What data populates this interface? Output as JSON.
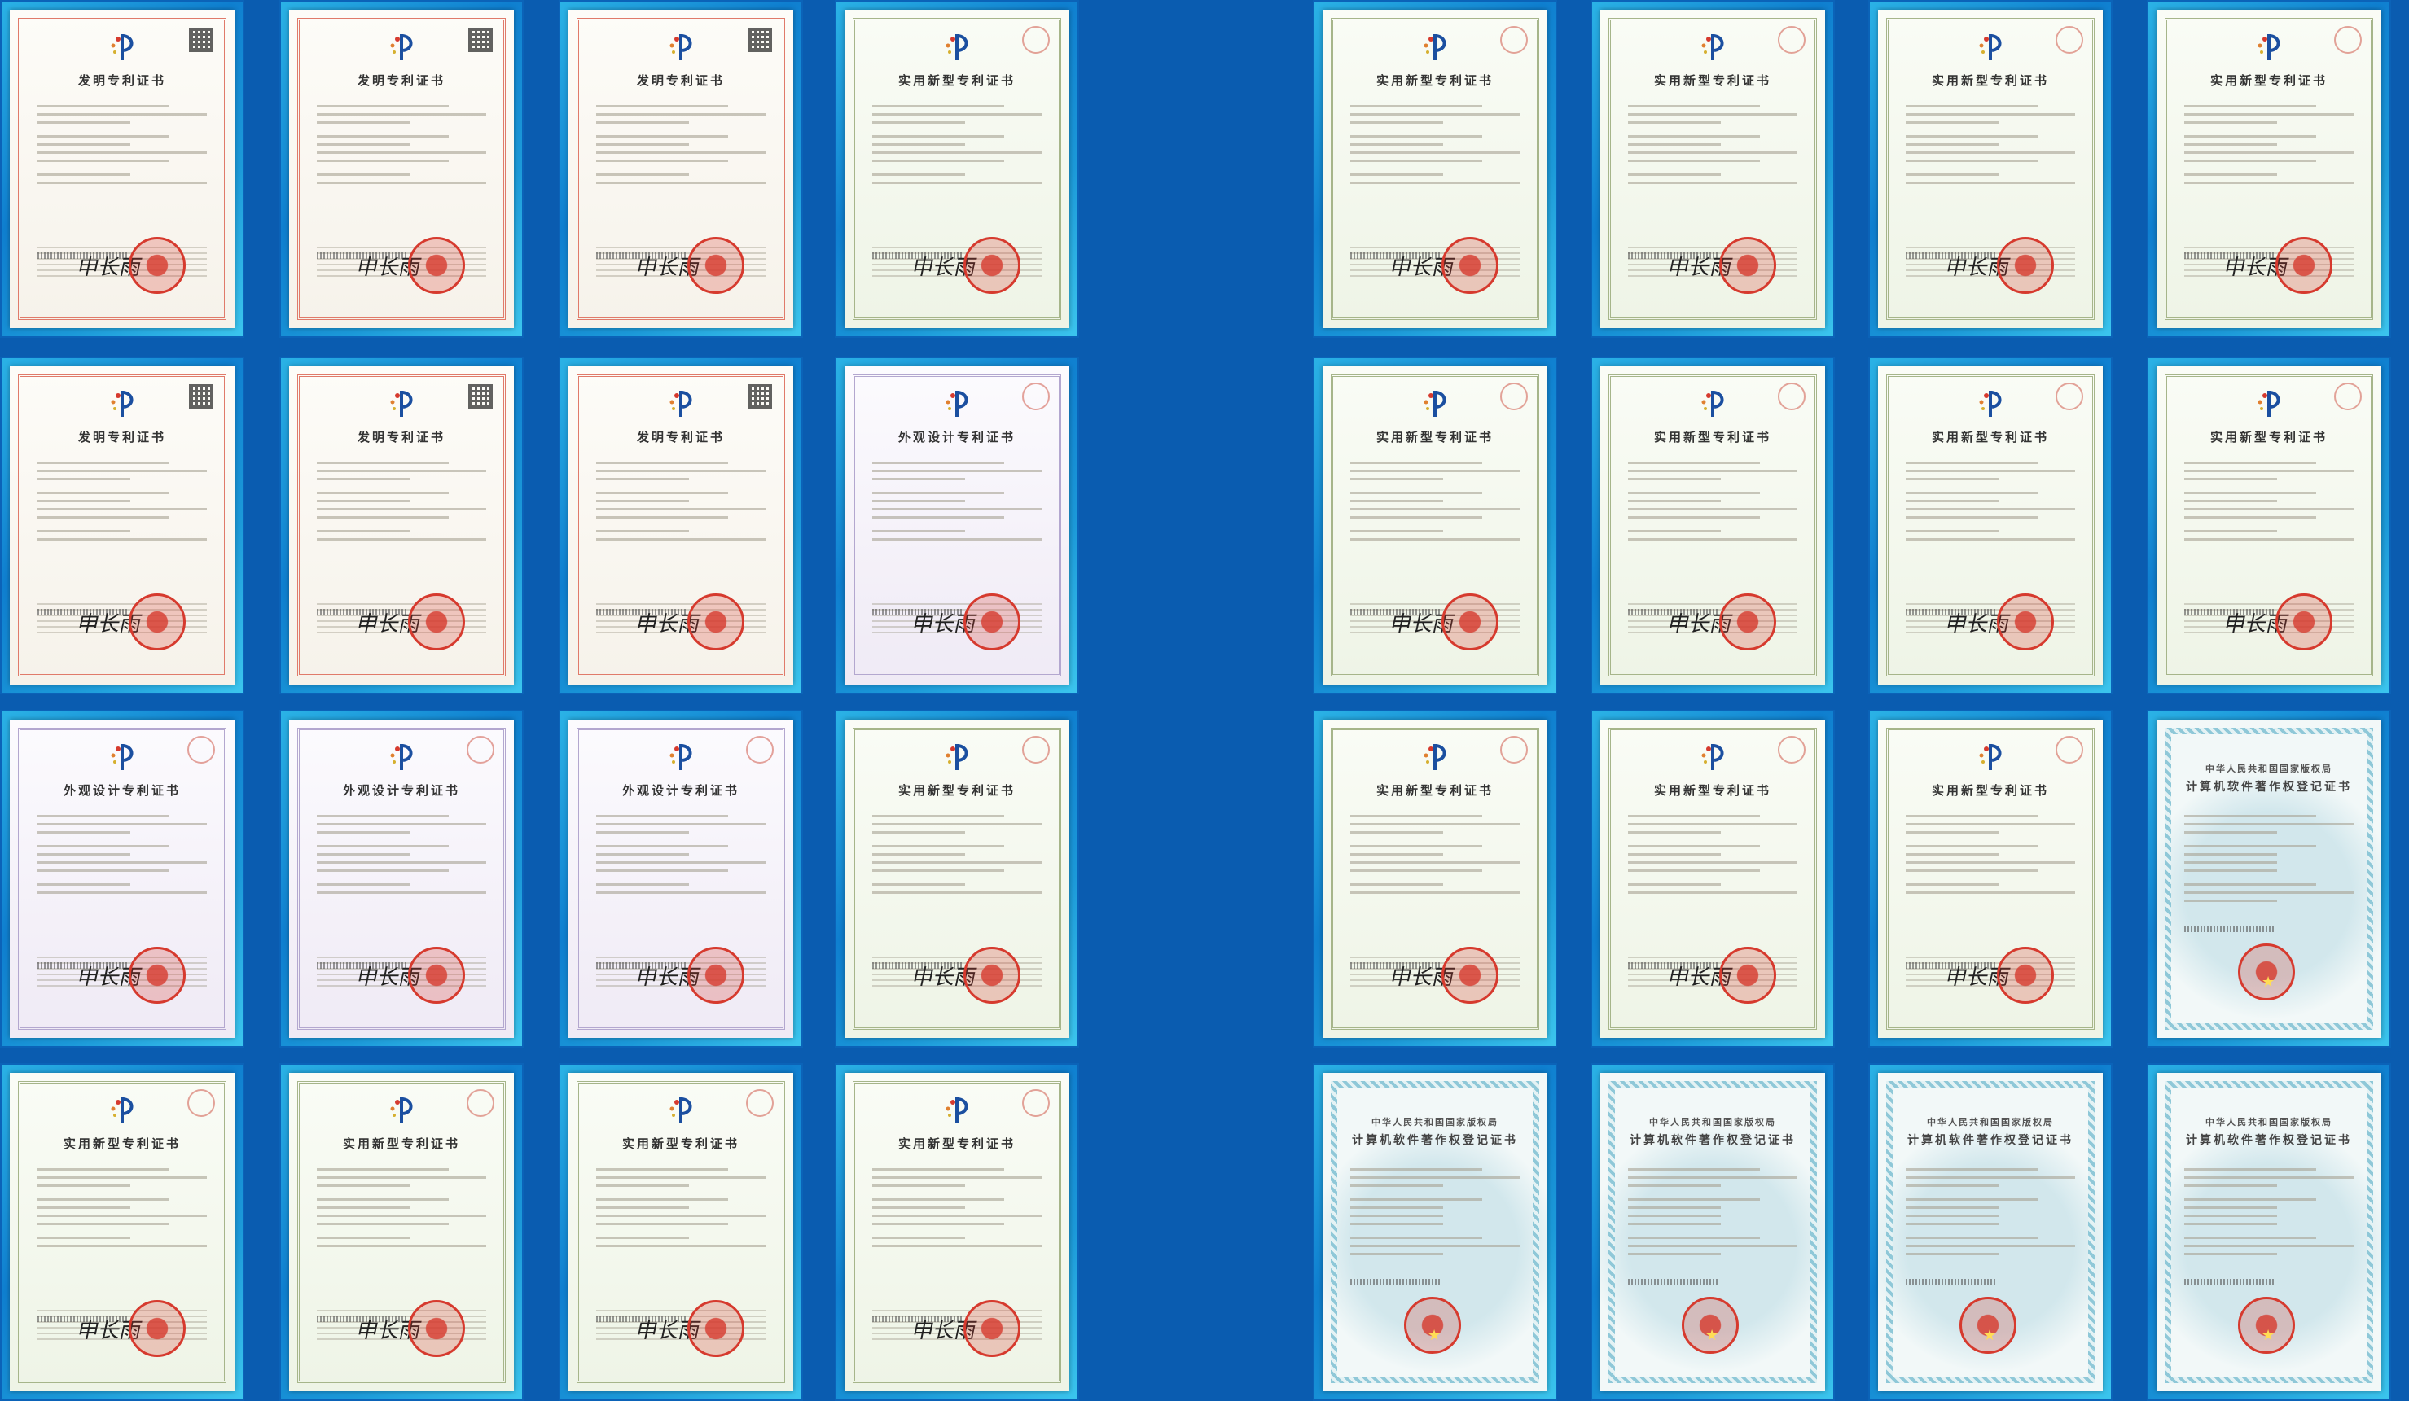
{
  "background_color": "#0a5cb0",
  "certificate_types": {
    "invention": "发明专利证书",
    "utility": "实用新型专利证书",
    "design": "外观设计专利证书",
    "software_org": "中华人民共和国国家版权局",
    "software": "计算机软件著作权登记证书"
  },
  "left_panel": {
    "rows": [
      [
        "invention",
        "invention",
        "invention",
        "utility"
      ],
      [
        "invention",
        "invention",
        "invention",
        "design"
      ],
      [
        "design",
        "design",
        "design",
        "utility"
      ],
      [
        "utility",
        "utility",
        "utility",
        "utility"
      ]
    ]
  },
  "right_panel": {
    "rows": [
      [
        "utility",
        "utility",
        "utility",
        "utility"
      ],
      [
        "utility",
        "utility",
        "utility",
        "utility"
      ],
      [
        "utility",
        "utility",
        "utility",
        "software"
      ],
      [
        "software",
        "software",
        "software",
        "software"
      ]
    ]
  }
}
